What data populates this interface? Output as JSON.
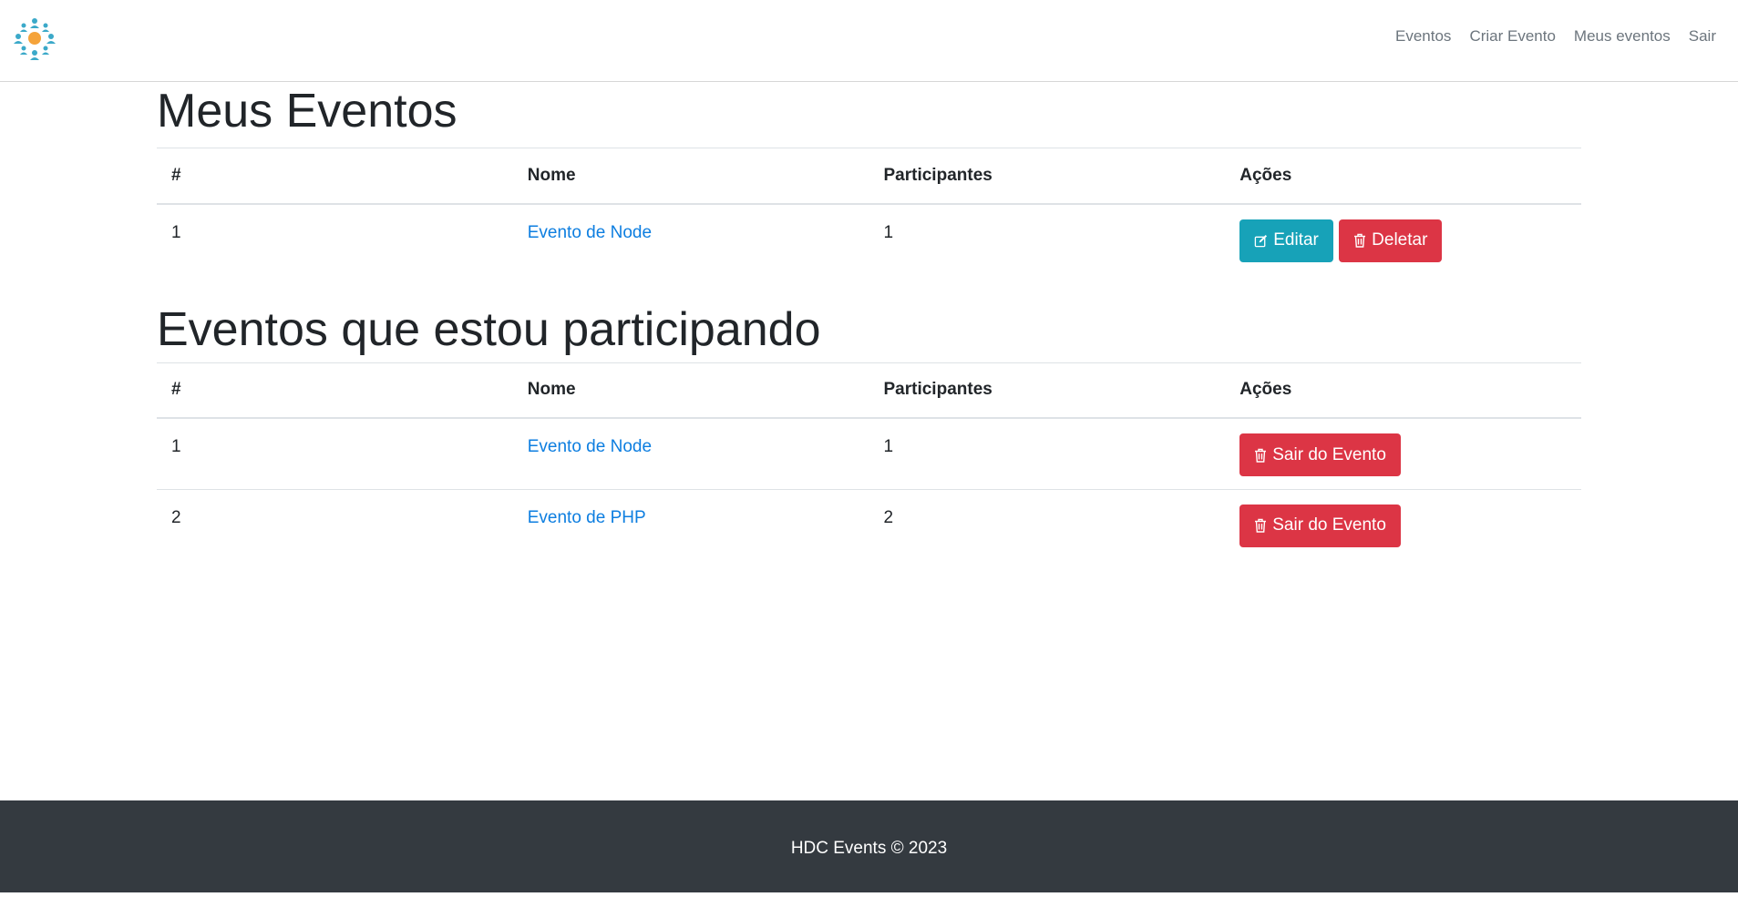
{
  "nav": {
    "links": [
      "Eventos",
      "Criar Evento",
      "Meus eventos",
      "Sair"
    ]
  },
  "my_events": {
    "title": "Meus Eventos",
    "columns": [
      "#",
      "Nome",
      "Participantes",
      "Ações"
    ],
    "rows": [
      {
        "num": "1",
        "name": "Evento de Node",
        "participants": "1"
      }
    ],
    "edit_label": "Editar",
    "delete_label": "Deletar"
  },
  "participating": {
    "title": "Eventos que estou participando",
    "columns": [
      "#",
      "Nome",
      "Participantes",
      "Ações"
    ],
    "rows": [
      {
        "num": "1",
        "name": "Evento de Node",
        "participants": "1"
      },
      {
        "num": "2",
        "name": "Evento de PHP",
        "participants": "2"
      }
    ],
    "leave_label": "Sair do Evento"
  },
  "footer": {
    "text": "HDC Events © 2023"
  },
  "colors": {
    "primary_link": "#0d7ee0",
    "info": "#17a2b8",
    "danger": "#dc3545",
    "footer_bg": "#343a40",
    "logo_people": "#3ba9c9",
    "logo_center": "#f5a33a"
  },
  "icons": {
    "edit": "edit-icon",
    "delete": "trash-icon",
    "logo": "people-network-logo"
  }
}
